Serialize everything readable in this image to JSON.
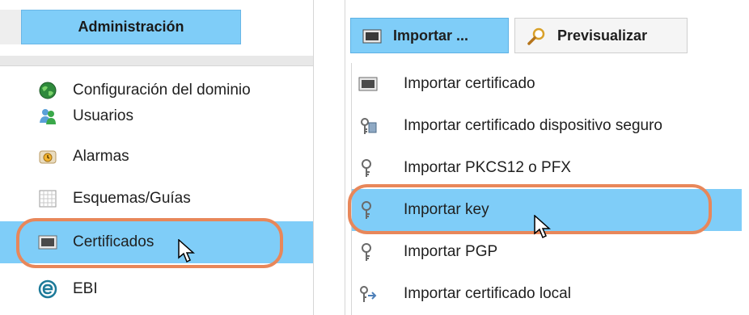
{
  "left_menu": {
    "header": "Administración",
    "items": [
      {
        "label": "Configuración del dominio",
        "icon": "globe-icon"
      },
      {
        "label": "Usuarios",
        "icon": "users-icon"
      },
      {
        "label": "Alarmas",
        "icon": "alarm-clock-icon"
      },
      {
        "label": "Esquemas/Guías",
        "icon": "grid-icon"
      },
      {
        "label": "Certificados",
        "icon": "certificate-icon",
        "selected": true
      },
      {
        "label": "EBI",
        "icon": "ebi-icon"
      }
    ]
  },
  "right_menu": {
    "toolbar": {
      "import_label": "Importar ...",
      "preview_label": "Previsualizar"
    },
    "items": [
      {
        "label": "Importar certificado",
        "icon": "certificate-icon"
      },
      {
        "label": "Importar certificado dispositivo seguro",
        "icon": "secure-device-icon"
      },
      {
        "label": "Importar PKCS12 o PFX",
        "icon": "key-icon"
      },
      {
        "label": "Importar key",
        "icon": "key-icon",
        "selected": true
      },
      {
        "label": "Importar PGP",
        "icon": "key-icon"
      },
      {
        "label": "Importar certificado local",
        "icon": "local-key-icon"
      }
    ]
  },
  "colors": {
    "selection": "#7fcdf8",
    "highlight_ring": "#e8875a"
  }
}
